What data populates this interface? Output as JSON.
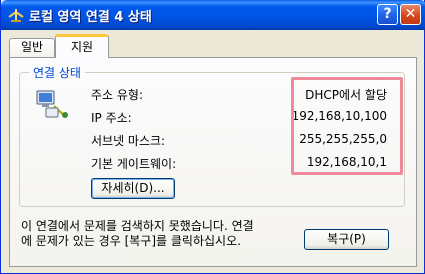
{
  "window": {
    "title": "로컬 영역 연결 4 상태",
    "help_label": "?",
    "close_label": "✕",
    "title_icon": "network-connection-icon",
    "colors": {
      "titlebar": "#0054e3",
      "group_label": "#0046d5",
      "highlight": "#ef8a9a"
    }
  },
  "tabs": [
    {
      "label": "일반",
      "active": false
    },
    {
      "label": "지원",
      "active": true
    }
  ],
  "connection_status": {
    "heading": "연결 상태",
    "icon": "network-computer-icon",
    "rows": [
      {
        "label": "주소 유형:",
        "value": "DHCP에서 할당"
      },
      {
        "label": "IP 주소:",
        "value": "192,168,10,100"
      },
      {
        "label": "서브넷 마스크:",
        "value": "255,255,255,0"
      },
      {
        "label": "기본 게이트웨이:",
        "value": "192,168,10,1"
      }
    ],
    "details_button": "자세히(D)..."
  },
  "repair": {
    "message": "이 연결에서 문제를 검색하지 못했습니다. 연결\n에 문제가 있는 경우 [복구]를 클릭하십시오.",
    "button": "복구(P)"
  }
}
